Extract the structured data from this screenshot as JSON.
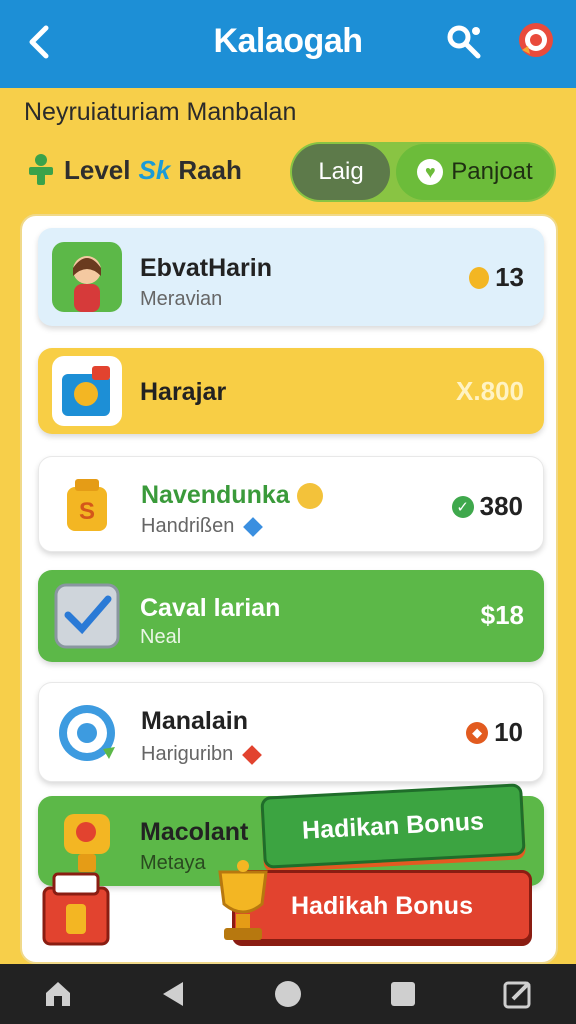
{
  "header": {
    "title": "Kalaogah",
    "icons": [
      "back-arrow-icon",
      "share-icon",
      "settings-icon"
    ],
    "accent_color": "#1d8fd6"
  },
  "subtitle": "Neyruiaturiam Manbalan",
  "level": {
    "label": "Level",
    "tag": "Sk",
    "suffix": "Raah"
  },
  "toggle": {
    "option_a": "Laig",
    "option_b": "Panjoat",
    "option_b_icon": "heart-icon"
  },
  "cards": [
    {
      "name": "EbvatHarin",
      "sub": "Meravian",
      "value": "13",
      "value_icon": "coin-icon",
      "bg": "#dff0fb"
    },
    {
      "name": "Harajar",
      "sub": "",
      "value": "X.800",
      "value_icon": "",
      "bg": "#f8ce45"
    },
    {
      "name": "Navendunka",
      "sub": "Handrißen",
      "value": "380",
      "value_icon": "check-icon",
      "bg": "#ffffff"
    },
    {
      "name": "Caval larian",
      "sub": "Neal",
      "value": "$18",
      "value_icon": "",
      "bg": "#5cb848"
    },
    {
      "name": "Manalain",
      "sub": "Hariguribn",
      "value": "10",
      "value_icon": "gem-icon",
      "bg": "#ffffff"
    },
    {
      "name": "Macolant",
      "sub": "Metaya",
      "value": "",
      "value_icon": "",
      "bg": "#5cb848"
    }
  ],
  "bonus": {
    "green_label": "Hadikan Bonus",
    "red_label": "Hadikah Bonus"
  },
  "navbar": {
    "items": [
      "home-icon",
      "back-triangle-icon",
      "circle-home-icon",
      "square-recents-icon",
      "edit-icon"
    ]
  }
}
